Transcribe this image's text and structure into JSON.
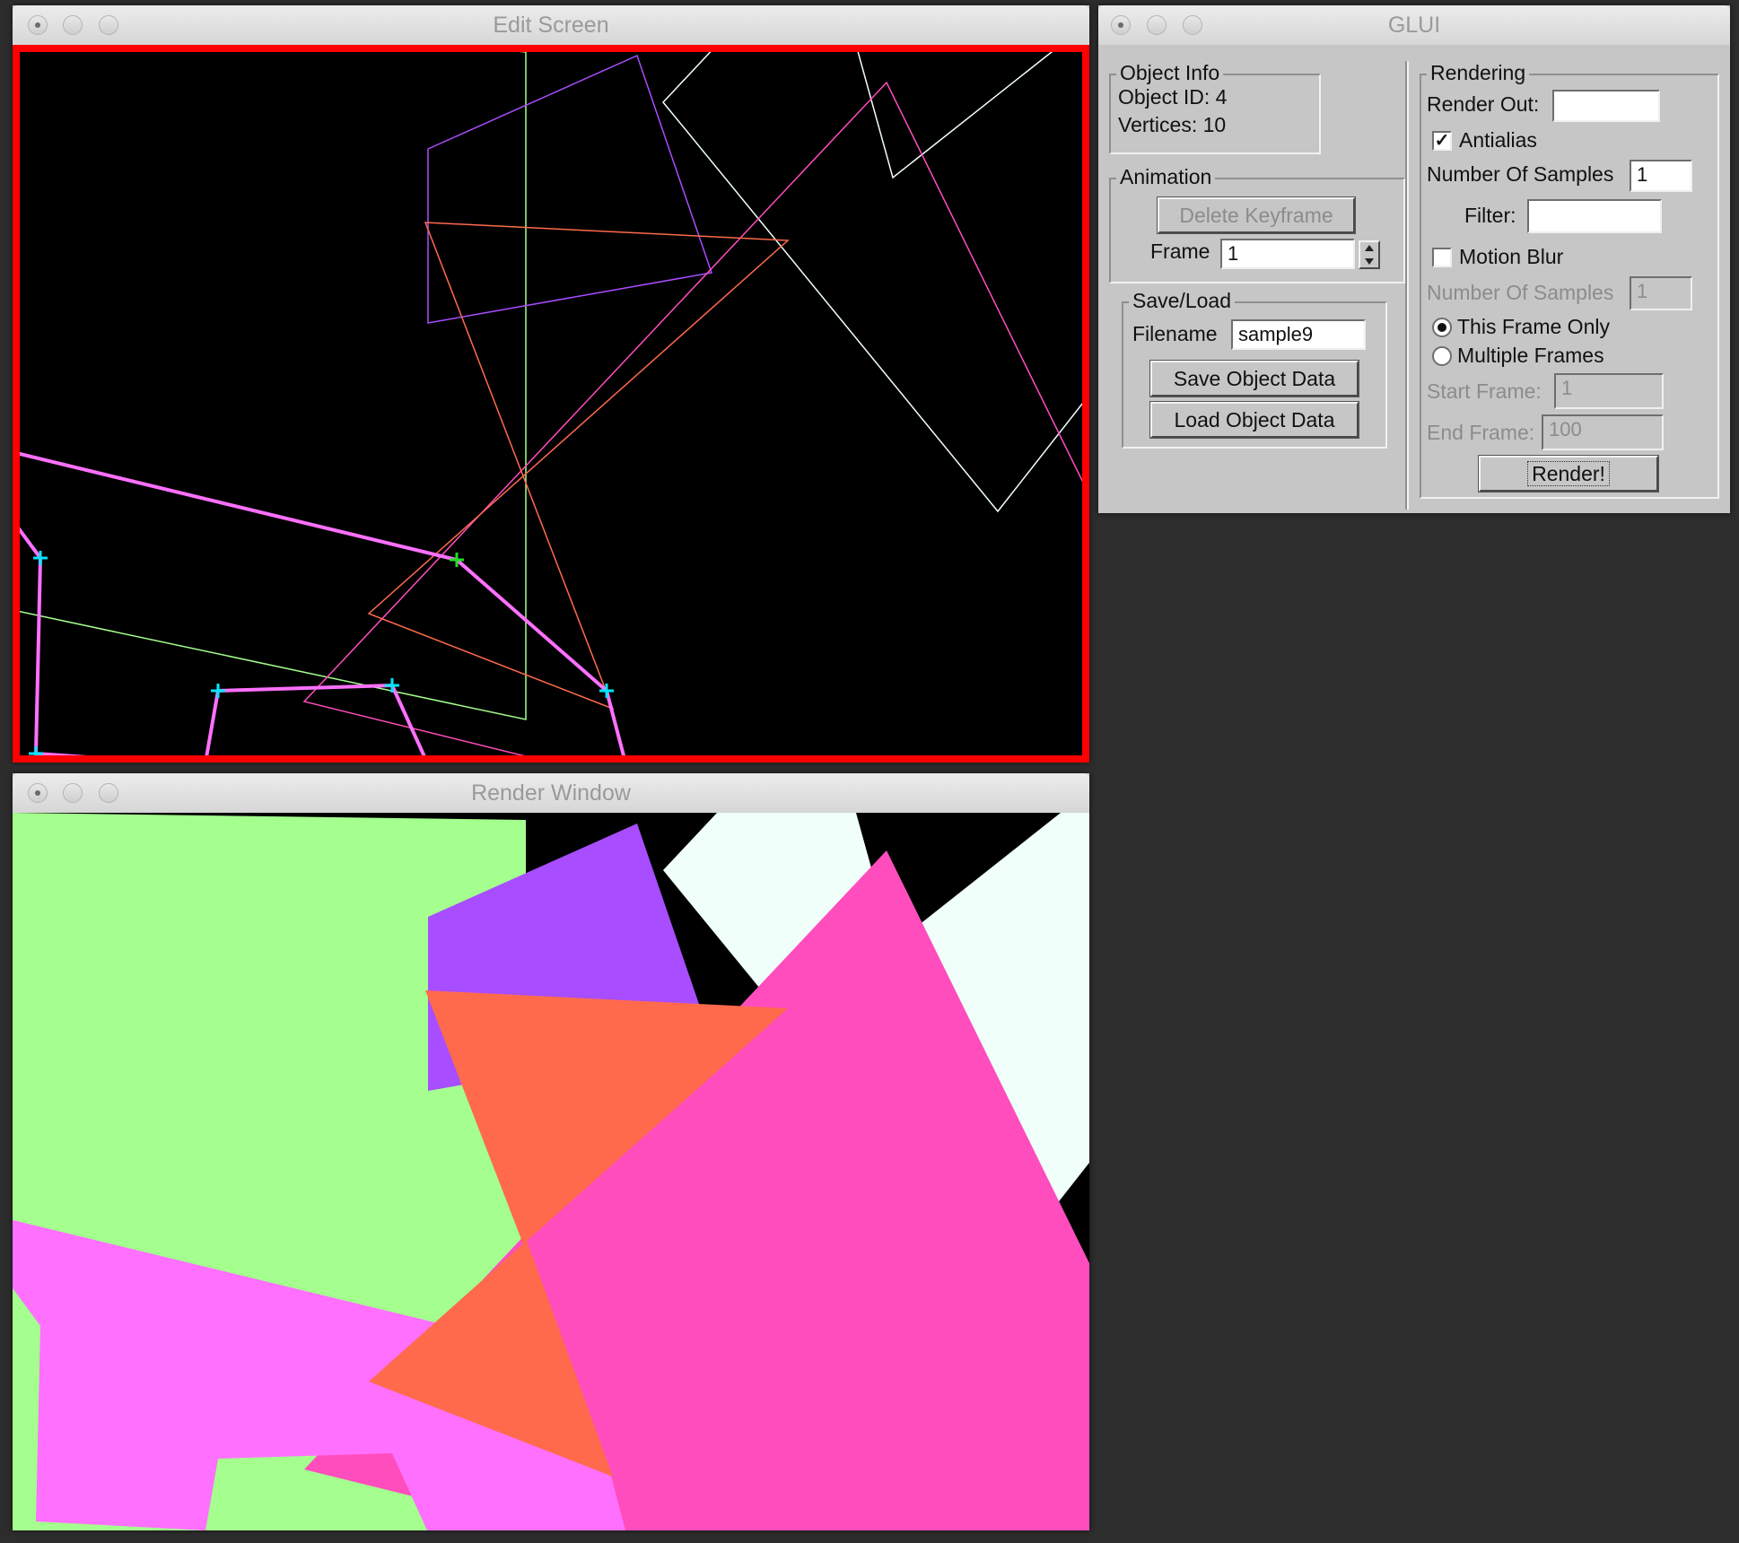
{
  "edit_window": {
    "title": "Edit Screen"
  },
  "render_window": {
    "title": "Render Window"
  },
  "glui": {
    "title": "GLUI",
    "object_info": {
      "legend": "Object Info",
      "object_id": "Object ID: 4",
      "vertices": "Vertices: 10"
    },
    "animation": {
      "legend": "Animation",
      "delete_keyframe": "Delete Keyframe",
      "frame_label": "Frame",
      "frame_value": "1"
    },
    "save_load": {
      "legend": "Save/Load",
      "filename_label": "Filename",
      "filename_value": "sample9",
      "save_button": "Save Object Data",
      "load_button": "Load Object Data"
    },
    "rendering": {
      "legend": "Rendering",
      "render_out_label": "Render Out:",
      "render_out_value": "",
      "antialias_label": "Antialias",
      "antialias_checked": true,
      "aa_samples_label": "Number Of Samples",
      "aa_samples_value": "1",
      "filter_label": "Filter:",
      "filter_value": "",
      "motion_blur_label": "Motion Blur",
      "motion_blur_checked": false,
      "mb_samples_label": "Number Of Samples",
      "mb_samples_value": "1",
      "this_frame_only": "This Frame Only",
      "multiple_frames": "Multiple Frames",
      "start_frame_label": "Start Frame:",
      "start_frame_value": "1",
      "end_frame_label": "End Frame:",
      "end_frame_value": "100",
      "render_button": "Render!"
    }
  },
  "colors": {
    "selection_border": "#ff0000",
    "vertex_marker": "#00e5ff",
    "selected_vertex_marker": "#22dd22",
    "green_poly": "#a4ff8e",
    "purple_poly": "#a84dff",
    "white_poly": "#f0fffa",
    "pink_poly": "#ff4dbd",
    "orange_poly": "#ff6a4d",
    "violet_poly": "#ff70ff"
  }
}
